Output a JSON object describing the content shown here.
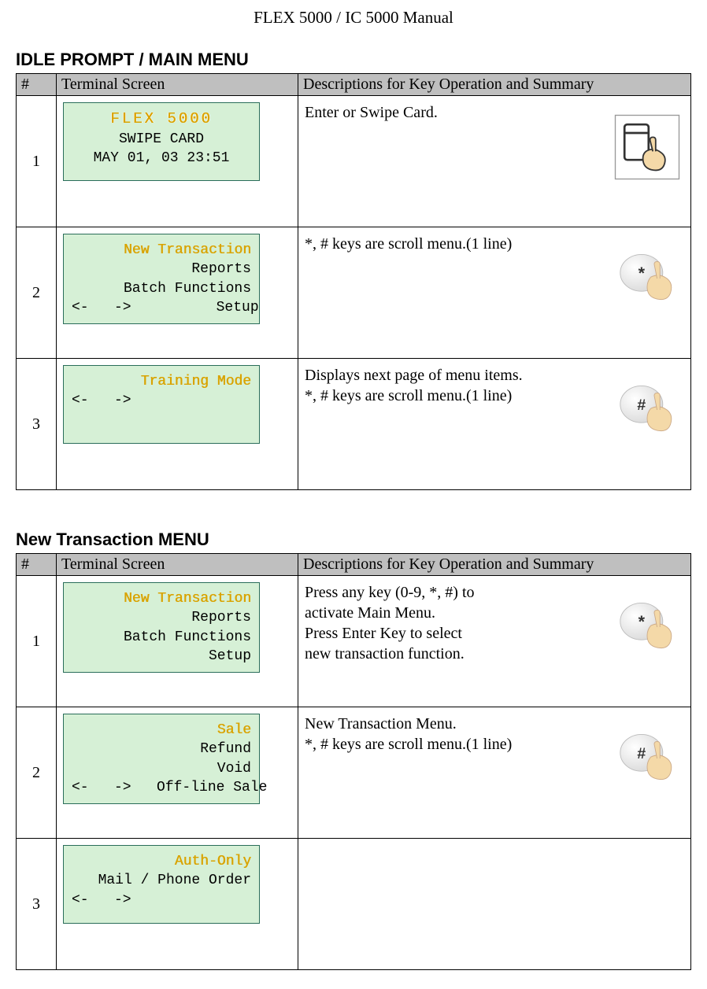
{
  "doc_title": "FLEX 5000 / IC 5000 Manual",
  "section1_title": "IDLE PROMPT / MAIN MENU",
  "section2_title": "New Transaction MENU",
  "headers": {
    "num": "#",
    "screen": "Terminal Screen",
    "desc": "Descriptions for Key Operation and Summary"
  },
  "idle_rows": [
    {
      "num": "1",
      "screen": {
        "title": "FLEX 5000",
        "line2": "SWIPE CARD",
        "line3": "",
        "line4": "MAY 01, 03 23:51"
      },
      "desc": "Enter or Swipe Card.",
      "icon": "swipe"
    },
    {
      "num": "2",
      "screen": {
        "hl": "New Transaction",
        "line2": "Reports",
        "line3": "Batch Functions",
        "line4": "<-   ->          Setup"
      },
      "desc": "*, # keys are scroll menu.(1 line)",
      "icon": "star"
    },
    {
      "num": "3",
      "screen": {
        "hl": "Training Mode",
        "line2": "",
        "line3": "",
        "line4": "<-   ->"
      },
      "desc": "Displays next page of menu items.\n*, # keys are scroll menu.(1 line)",
      "icon": "hash"
    }
  ],
  "nt_rows": [
    {
      "num": "1",
      "screen": {
        "hl": "New Transaction",
        "line2": "Reports",
        "line3": "Batch Functions",
        "line4": "Setup"
      },
      "desc": "Press any key (0-9,  *, #) to\nactivate Main Menu.\nPress Enter Key to select\nnew transaction function.",
      "icon": "star"
    },
    {
      "num": "2",
      "screen": {
        "hl": "Sale",
        "line2": "Refund",
        "line3": "Void",
        "line4": "<-   ->   Off-line Sale"
      },
      "desc": "New Transaction Menu.\n*, # keys are scroll menu.(1 line)",
      "icon": "hash"
    },
    {
      "num": "3",
      "screen": {
        "hl": "Auth-Only",
        "line2": "Mail / Phone Order",
        "line3": "",
        "line4": "<-   ->"
      },
      "desc": "",
      "icon": ""
    }
  ]
}
